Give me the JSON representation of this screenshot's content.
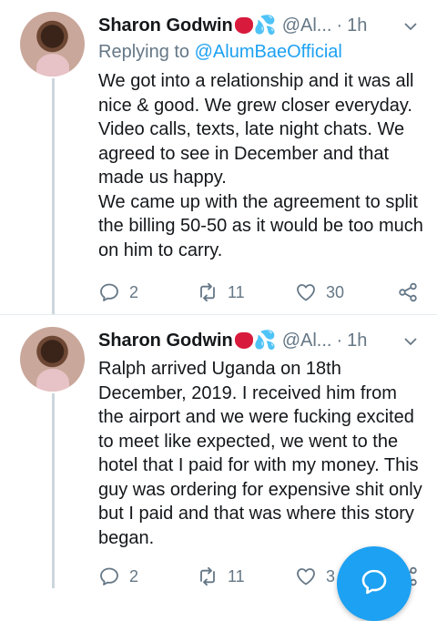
{
  "tweets": [
    {
      "name": "Sharon Godwin",
      "handle": "@Al...",
      "separator": "·",
      "time": "1h",
      "reply_prefix": "Replying to ",
      "reply_mention": "@AlumBaeOfficial",
      "text": "We got into a relationship and it was all nice & good. We grew closer everyday. Video calls, texts, late night chats. We agreed to see in December and that made us happy.\nWe came up with the agreement to split the billing 50-50 as it would be too much on him to carry.",
      "replies": "2",
      "retweets": "11",
      "likes": "30"
    },
    {
      "name": "Sharon Godwin",
      "handle": "@Al...",
      "separator": "·",
      "time": "1h",
      "text": "Ralph arrived Uganda on 18th December, 2019. I received him from the airport and we were fucking excited to meet like expected, we went to the hotel that I paid for with my money. This guy was ordering for expensive shit only but I paid and that was where this story began.",
      "replies": "2",
      "retweets": "11",
      "likes": "3"
    }
  ],
  "icons": {
    "name_emoji": [
      "tongue-emoji",
      "sweat-droplets-emoji"
    ],
    "actions": [
      "reply-icon",
      "retweet-icon",
      "like-icon",
      "share-icon"
    ],
    "fab": "compose-icon"
  },
  "colors": {
    "accent": "#1da1f2",
    "secondary_text": "#657786",
    "primary_text": "#14171a"
  }
}
